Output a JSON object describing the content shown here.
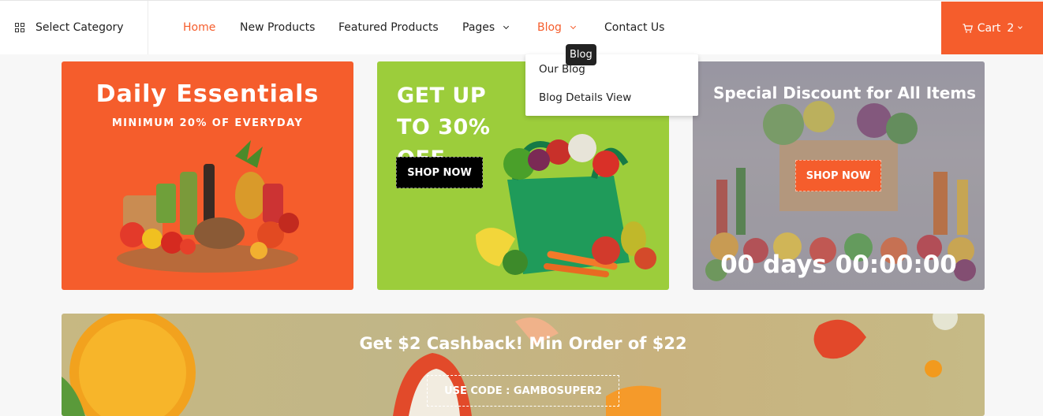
{
  "nav": {
    "select_category": "Select Category",
    "items": [
      {
        "label": "Home",
        "active": true
      },
      {
        "label": "New Products"
      },
      {
        "label": "Featured Products"
      },
      {
        "label": "Pages",
        "has_dropdown": true
      },
      {
        "label": "Blog",
        "has_dropdown": true,
        "highlighted": true
      },
      {
        "label": "Contact Us"
      }
    ],
    "cart_label": "Cart",
    "cart_count": "2"
  },
  "tooltip": "Blog",
  "blog_dropdown": [
    "Our Blog",
    "Blog Details View"
  ],
  "banners": {
    "daily": {
      "title": "Daily Essentials",
      "subtitle": "MINIMUM 20% OF EVERYDAY"
    },
    "offer": {
      "title": "GET UP TO 30% OFF",
      "button": "SHOP NOW"
    },
    "special": {
      "title": "Special Discount for All Items",
      "button": "SHOP NOW",
      "countdown": "00 days 00:00:00"
    }
  },
  "cashback": {
    "title": "Get $2 Cashback! Min Order of $22",
    "code": "USE CODE : GAMBOSUPER2"
  },
  "colors": {
    "accent": "#f55d2c",
    "green_banner": "#9ccd3b",
    "dark": "#000000"
  }
}
